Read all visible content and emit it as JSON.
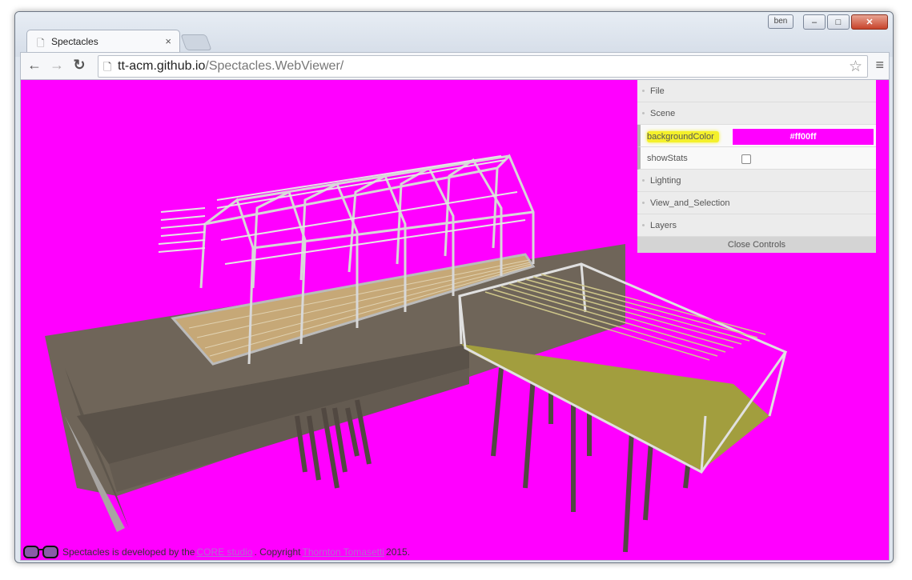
{
  "window": {
    "user_badge": "ben",
    "minimize": "–",
    "maximize": "□",
    "close": "✕"
  },
  "tab": {
    "title": "Spectacles",
    "close": "×"
  },
  "toolbar": {
    "back": "←",
    "forward": "→",
    "reload": "↻",
    "url_host": "tt-acm.github.io",
    "url_path": "/Spectacles.WebViewer/",
    "star": "☆",
    "menu": "≡"
  },
  "controls": {
    "file": "File",
    "scene": "Scene",
    "background_label": "backgroundColor",
    "background_value": "#ff00ff",
    "background_display": "#ff00ff",
    "show_stats_label": "showStats",
    "lighting": "Lighting",
    "view_selection": "View_and_Selection",
    "layers": "Layers",
    "close_controls": "Close Controls"
  },
  "footer": {
    "text1": "Spectacles is developed by the",
    "link1": "CORE studio",
    "text2": ". Copyright",
    "link2": "Thornton Tomasetti",
    "text3": "2015."
  },
  "colors": {
    "background": "#ff00ff",
    "highlight": "#f4f02b"
  }
}
